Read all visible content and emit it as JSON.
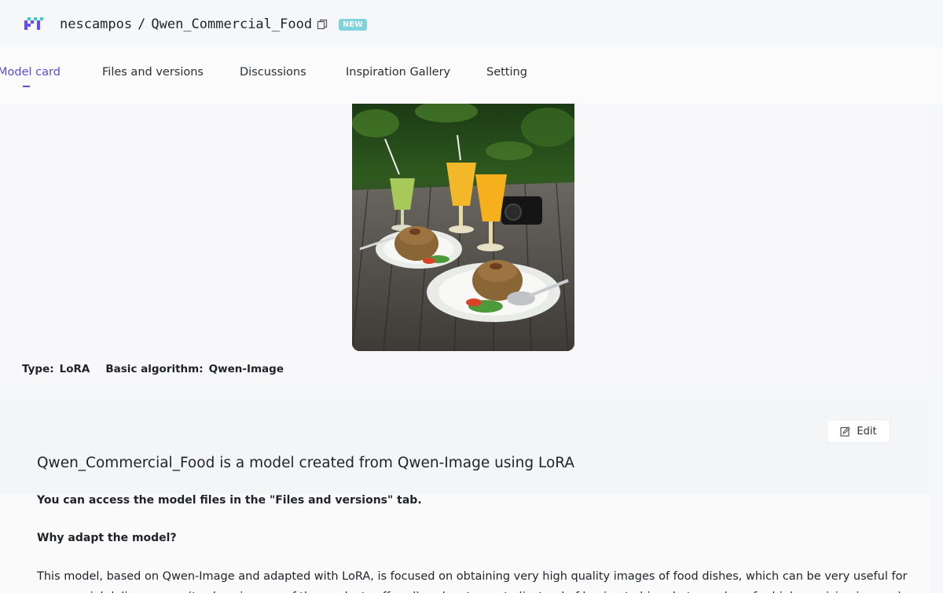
{
  "header": {
    "owner": "nescampos",
    "separator": "/",
    "repo_name": "Qwen_Commercial_Food",
    "badge": "NEW",
    "accent_color": "#5a4fd6",
    "badge_color": "#7fd3dc"
  },
  "tabs": [
    {
      "label": "Model card",
      "active": true
    },
    {
      "label": "Files and versions",
      "active": false
    },
    {
      "label": "Discussions",
      "active": false
    },
    {
      "label": "Inspiration Gallery",
      "active": false
    },
    {
      "label": "Setting",
      "active": false
    }
  ],
  "model_meta": {
    "type_label": "Type:",
    "type_value": "LoRA",
    "algorithm_label": "Basic algorithm:",
    "algorithm_value": "Qwen-Image"
  },
  "readme": {
    "edit_label": "Edit",
    "title": "Qwen_Commercial_Food is a model created from Qwen-Image using LoRA",
    "access_note": "You can access the model files in the \"Files and versions\" tab.",
    "why_heading": "Why adapt the model?",
    "body_line1": "This model, based on Qwen-Image and adapted with LoRA, is focused on obtaining very high quality images of food dishes, which can be very useful for",
    "body_line2": "commercial delivery apps (to show images of the products offered) and restaurants (instead of having to hire photographers for high-precision images)."
  },
  "icons": {
    "logo": "modelscope-logo-icon",
    "copy": "copy-icon",
    "edit": "edit-icon"
  }
}
